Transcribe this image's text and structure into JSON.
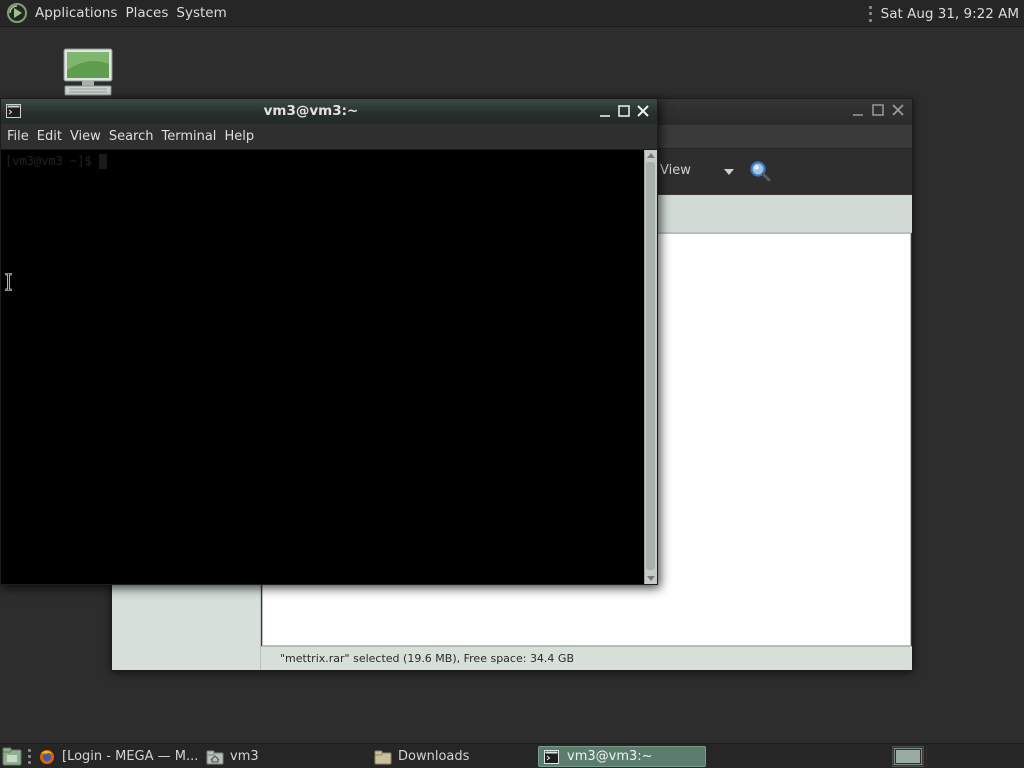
{
  "top_panel": {
    "menus": [
      "Applications",
      "Places",
      "System"
    ],
    "clock": "Sat Aug 31,  9:22 AM"
  },
  "desktop": {
    "icon": "computer-icon"
  },
  "file_manager": {
    "toolbar": {
      "view_label": "View",
      "search_icon": "magnifier-icon"
    },
    "status_text": "\"mettrix.rar\" selected (19.6 MB), Free space: 34.4 GB"
  },
  "terminal": {
    "title": "vm3@vm3:~",
    "menus": [
      "File",
      "Edit",
      "View",
      "Search",
      "Terminal",
      "Help"
    ],
    "prompt": "[vm3@vm3 ~]$ "
  },
  "bottom_panel": {
    "tasks": [
      {
        "label": "[Login - MEGA — M...",
        "icon": "firefox-icon"
      },
      {
        "label": "vm3",
        "icon": "home-folder-icon"
      },
      {
        "label": "Downloads",
        "icon": "folder-icon"
      },
      {
        "label": "vm3@vm3:~",
        "icon": "terminal-icon",
        "active": true
      }
    ]
  },
  "colors": {
    "panel_bg": "#262626",
    "desktop_bg": "#2d2d2d",
    "accent_green": "#5c7c6e",
    "sidebar_bg": "#d6e0d9"
  }
}
